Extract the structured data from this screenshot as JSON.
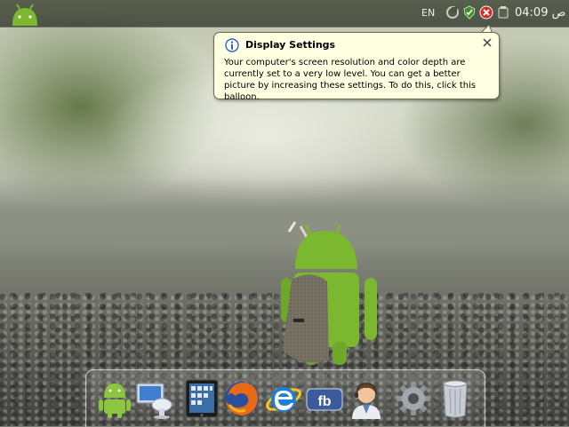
{
  "topbar": {
    "language": "EN",
    "clock": "04:09 ص",
    "tray_icons": [
      "network-icon",
      "shield-icon",
      "security-alert-icon",
      "volume-icon"
    ]
  },
  "balloon": {
    "title": "Display Settings",
    "message": "Your computer's screen resolution and color depth are currently set to a very low level. You can get a better picture by increasing these settings. To do this, click this balloon.",
    "icon": "info-icon"
  },
  "dock": {
    "items": [
      {
        "name": "android-icon"
      },
      {
        "name": "computer-icon"
      },
      {
        "name": "tablet-icon"
      },
      {
        "name": "firefox-icon"
      },
      {
        "name": "internet-explorer-icon"
      },
      {
        "name": "facebook-icon"
      },
      {
        "name": "support-user-icon"
      },
      {
        "name": "settings-gear-icon"
      },
      {
        "name": "recycle-bin-icon"
      }
    ]
  },
  "colors": {
    "balloon_bg": "#ffffe1",
    "android_green": "#7cb82f",
    "alert_red": "#d9281e"
  }
}
